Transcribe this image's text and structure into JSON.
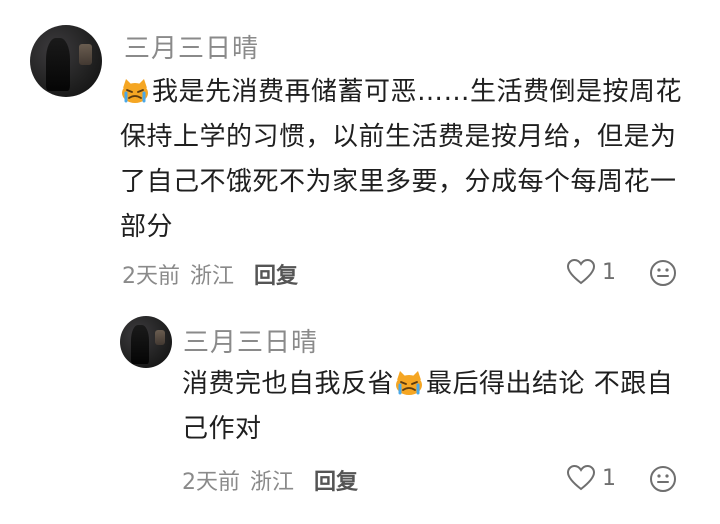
{
  "comments": [
    {
      "username": "三月三日晴",
      "emoji": "cat-crying-emoji",
      "text": "我是先消费再储蓄可恶……生活费倒是按周花保持上学的习惯，以前生活费是按月给，但是为了自己不饿死不为家里多要，分成每个每周花一部分",
      "time": "2天前",
      "location": "浙江",
      "reply_label": "回复",
      "likes": "1"
    },
    {
      "username": "三月三日晴",
      "text_before_emoji": "消费完也自我反省",
      "emoji": "cat-crying-emoji",
      "text_after_emoji": "最后得出结论 不跟自己作对",
      "time": "2天前",
      "location": "浙江",
      "reply_label": "回复",
      "likes": "1"
    }
  ],
  "colors": {
    "text": "#1f1f1f",
    "muted": "#8a8a8a",
    "emoji_orange": "#f5a623"
  }
}
